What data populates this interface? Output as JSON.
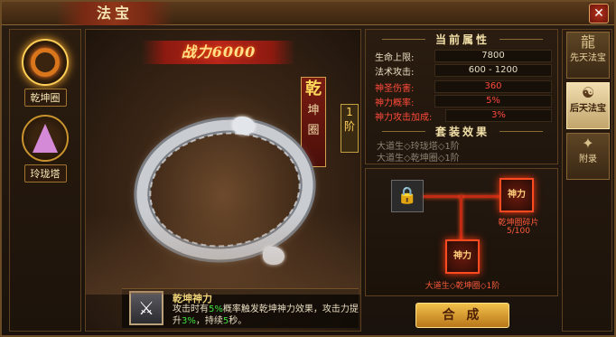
{
  "window": {
    "title": "法宝",
    "close_label": "✕"
  },
  "left_items": [
    {
      "label": "乾坤圈",
      "icon": "ring-icon",
      "selected": true
    },
    {
      "label": "玲珑塔",
      "icon": "tower-icon",
      "selected": false
    }
  ],
  "showcase": {
    "power_text": "战力6000",
    "name_chars": [
      "乾",
      "坤",
      "圈"
    ],
    "tier_chars": [
      "1",
      "阶"
    ]
  },
  "skill": {
    "title": "乾坤神力",
    "desc_parts": [
      "攻击时有",
      "5%",
      "概率触发乾坤神力效果，攻击力提升",
      "3%",
      "，持续",
      "5",
      "秒。"
    ]
  },
  "current_attrs": {
    "heading": "当前属性",
    "rows": [
      {
        "key": "生命上限:",
        "value": "7800",
        "red": false
      },
      {
        "key": "法术攻击:",
        "value": "600 - 1200",
        "red": false
      },
      {
        "key": "神圣伤害:",
        "value": "360",
        "red": true
      },
      {
        "key": "神力概率:",
        "value": "5%",
        "red": true
      },
      {
        "key": "神力攻击加成:",
        "value": "3%",
        "red": true
      }
    ]
  },
  "set_effect": {
    "heading": "套装效果",
    "lines": [
      "大道生◇玲珑塔◇1阶",
      "大道生◇乾坤圈◇1阶"
    ]
  },
  "craft": {
    "shard_label": "乾坤圈碎片",
    "shard_count": "5/100",
    "target_label": "大道生◇乾坤圈◇1阶",
    "target_slot_text": "神力",
    "shard_slot_text": "神力"
  },
  "compose_label": "合 成",
  "tabs": [
    {
      "label": "先天法宝",
      "icon": "dragon-icon",
      "active": false
    },
    {
      "label": "后天法宝",
      "icon": "yinyang-icon",
      "active": true
    },
    {
      "label": "附录",
      "icon": "scroll-icon",
      "active": false
    }
  ],
  "colors": {
    "accent_red": "#ff4a3a",
    "highlight_green": "#3fe03f",
    "gold": "#ffd85a"
  }
}
